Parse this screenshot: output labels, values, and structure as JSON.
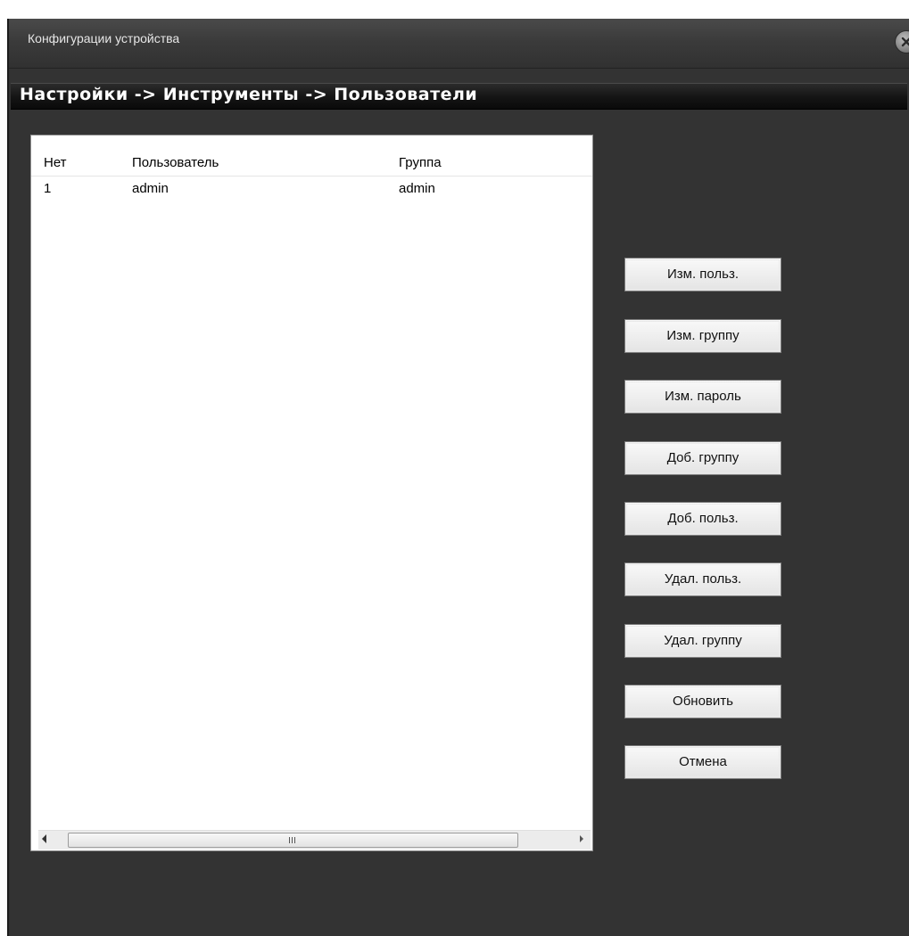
{
  "window": {
    "title": "Конфигурации устройства"
  },
  "breadcrumb": "Настройки -> Инструменты -> Пользователи",
  "table": {
    "columns": [
      "Нет",
      "Пользователь",
      "Группа"
    ],
    "rows": [
      {
        "no": "1",
        "user": "admin",
        "group": "admin"
      }
    ]
  },
  "scrollbar": {
    "grip": "III"
  },
  "buttons": {
    "edit_user": "Изм. польз.",
    "edit_group": "Изм. группу",
    "edit_password": "Изм. пароль",
    "add_group": "Доб. группу",
    "add_user": "Доб. польз.",
    "delete_user": "Удал. польз.",
    "delete_group": "Удал. группу",
    "refresh": "Обновить",
    "cancel": "Отмена"
  },
  "icons": {
    "close": "close-icon"
  },
  "colors": {
    "window_bg": "#333333",
    "breadcrumb_bg": "#0a0a0a",
    "list_bg": "#ffffff"
  }
}
